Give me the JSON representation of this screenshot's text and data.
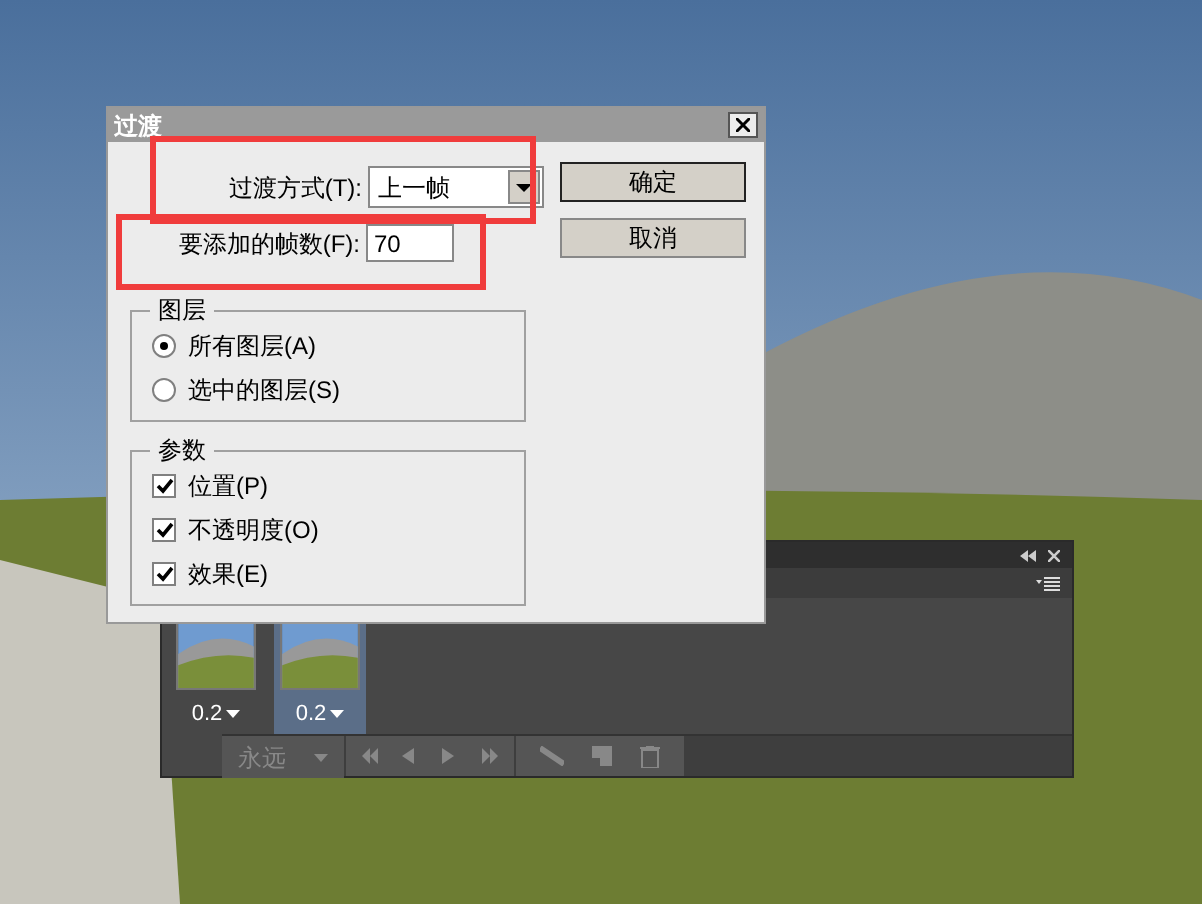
{
  "dialog": {
    "title": "过渡",
    "tween": {
      "label": "过渡方式(T):",
      "value": "上一帧"
    },
    "frames_to_add": {
      "label": "要添加的帧数(F):",
      "value": "70"
    },
    "buttons": [
      "确定",
      "取消"
    ],
    "layers": {
      "title": "图层",
      "options": [
        {
          "label": "所有图层(A)",
          "selected": true
        },
        {
          "label": "选中的图层(S)",
          "selected": false
        }
      ]
    },
    "parameters": {
      "title": "参数",
      "options": [
        {
          "label": "位置(P)",
          "checked": true
        },
        {
          "label": "不透明度(O)",
          "checked": true
        },
        {
          "label": "效果(E)",
          "checked": true
        }
      ]
    }
  },
  "animation_panel": {
    "frames": [
      {
        "delay": "0.2",
        "selected": false
      },
      {
        "delay": "0.2",
        "selected": true
      }
    ],
    "loop": "永远"
  }
}
